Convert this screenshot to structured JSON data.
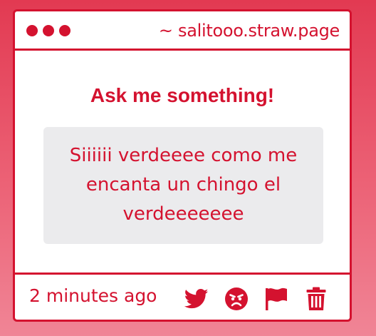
{
  "window": {
    "url": "~ salitooo.straw.page"
  },
  "main": {
    "heading": "Ask me something!",
    "message": "Siiiiii verdeeee como me encanta un chingo el verdeeeeeee"
  },
  "footer": {
    "timestamp": "2 minutes ago",
    "actions": [
      "twitter-icon",
      "angry-face-icon",
      "flag-icon",
      "trash-icon"
    ]
  },
  "colors": {
    "accent": "#d4122f",
    "message_background": "#ebebed",
    "page_gradient_top": "#e23a52",
    "page_gradient_bottom": "#f08596"
  }
}
